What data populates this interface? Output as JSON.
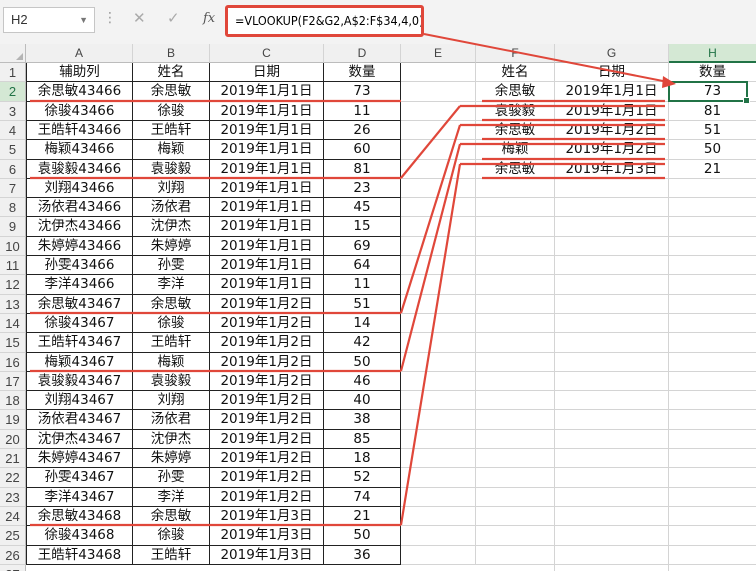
{
  "formula_bar": {
    "name_box": "H2",
    "formula": "=VLOOKUP(F2&G2,A$2:F$34,4,0)",
    "cancel_symbol": "✕",
    "enter_symbol": "✓",
    "fx_symbol": "fx"
  },
  "columns": [
    "A",
    "B",
    "C",
    "D",
    "E",
    "F",
    "G",
    "H"
  ],
  "selected_column": "H",
  "selected_row": 2,
  "header_row": {
    "A": "辅助列",
    "B": "姓名",
    "C": "日期",
    "D": "数量",
    "F": "姓名",
    "G": "日期",
    "H": "数量"
  },
  "rows": [
    {
      "n": 2,
      "A": "余思敏43466",
      "B": "余思敏",
      "C": "2019年1月1日",
      "D": "73"
    },
    {
      "n": 3,
      "A": "徐骏43466",
      "B": "徐骏",
      "C": "2019年1月1日",
      "D": "11"
    },
    {
      "n": 4,
      "A": "王皓轩43466",
      "B": "王皓轩",
      "C": "2019年1月1日",
      "D": "26"
    },
    {
      "n": 5,
      "A": "梅颖43466",
      "B": "梅颖",
      "C": "2019年1月1日",
      "D": "60"
    },
    {
      "n": 6,
      "A": "袁骏毅43466",
      "B": "袁骏毅",
      "C": "2019年1月1日",
      "D": "81"
    },
    {
      "n": 7,
      "A": "刘翔43466",
      "B": "刘翔",
      "C": "2019年1月1日",
      "D": "23"
    },
    {
      "n": 8,
      "A": "汤依君43466",
      "B": "汤依君",
      "C": "2019年1月1日",
      "D": "45"
    },
    {
      "n": 9,
      "A": "沈伊杰43466",
      "B": "沈伊杰",
      "C": "2019年1月1日",
      "D": "15"
    },
    {
      "n": 10,
      "A": "朱婷婷43466",
      "B": "朱婷婷",
      "C": "2019年1月1日",
      "D": "69"
    },
    {
      "n": 11,
      "A": "孙雯43466",
      "B": "孙雯",
      "C": "2019年1月1日",
      "D": "64"
    },
    {
      "n": 12,
      "A": "李洋43466",
      "B": "李洋",
      "C": "2019年1月1日",
      "D": "11"
    },
    {
      "n": 13,
      "A": "余思敏43467",
      "B": "余思敏",
      "C": "2019年1月2日",
      "D": "51"
    },
    {
      "n": 14,
      "A": "徐骏43467",
      "B": "徐骏",
      "C": "2019年1月2日",
      "D": "14"
    },
    {
      "n": 15,
      "A": "王皓轩43467",
      "B": "王皓轩",
      "C": "2019年1月2日",
      "D": "42"
    },
    {
      "n": 16,
      "A": "梅颖43467",
      "B": "梅颖",
      "C": "2019年1月2日",
      "D": "50"
    },
    {
      "n": 17,
      "A": "袁骏毅43467",
      "B": "袁骏毅",
      "C": "2019年1月2日",
      "D": "46"
    },
    {
      "n": 18,
      "A": "刘翔43467",
      "B": "刘翔",
      "C": "2019年1月2日",
      "D": "40"
    },
    {
      "n": 19,
      "A": "汤依君43467",
      "B": "汤依君",
      "C": "2019年1月2日",
      "D": "38"
    },
    {
      "n": 20,
      "A": "沈伊杰43467",
      "B": "沈伊杰",
      "C": "2019年1月2日",
      "D": "85"
    },
    {
      "n": 21,
      "A": "朱婷婷43467",
      "B": "朱婷婷",
      "C": "2019年1月2日",
      "D": "18"
    },
    {
      "n": 22,
      "A": "孙雯43467",
      "B": "孙雯",
      "C": "2019年1月2日",
      "D": "52"
    },
    {
      "n": 23,
      "A": "李洋43467",
      "B": "李洋",
      "C": "2019年1月2日",
      "D": "74"
    },
    {
      "n": 24,
      "A": "余思敏43468",
      "B": "余思敏",
      "C": "2019年1月3日",
      "D": "21"
    },
    {
      "n": 25,
      "A": "徐骏43468",
      "B": "徐骏",
      "C": "2019年1月3日",
      "D": "50"
    },
    {
      "n": 26,
      "A": "王皓轩43468",
      "B": "王皓轩",
      "C": "2019年1月3日",
      "D": "36"
    }
  ],
  "lookup_rows": [
    {
      "n": 2,
      "F": "余思敏",
      "G": "2019年1月1日",
      "H": "73",
      "source_row": 2
    },
    {
      "n": 3,
      "F": "袁骏毅",
      "G": "2019年1月1日",
      "H": "81",
      "source_row": 6
    },
    {
      "n": 4,
      "F": "余思敏",
      "G": "2019年1月2日",
      "H": "51",
      "source_row": 13
    },
    {
      "n": 5,
      "F": "梅颖",
      "G": "2019年1月2日",
      "H": "50",
      "source_row": 16
    },
    {
      "n": 6,
      "F": "余思敏",
      "G": "2019年1月3日",
      "H": "21",
      "source_row": 24
    }
  ],
  "annotation_color": "#e0473a",
  "selection_color": "#217346"
}
